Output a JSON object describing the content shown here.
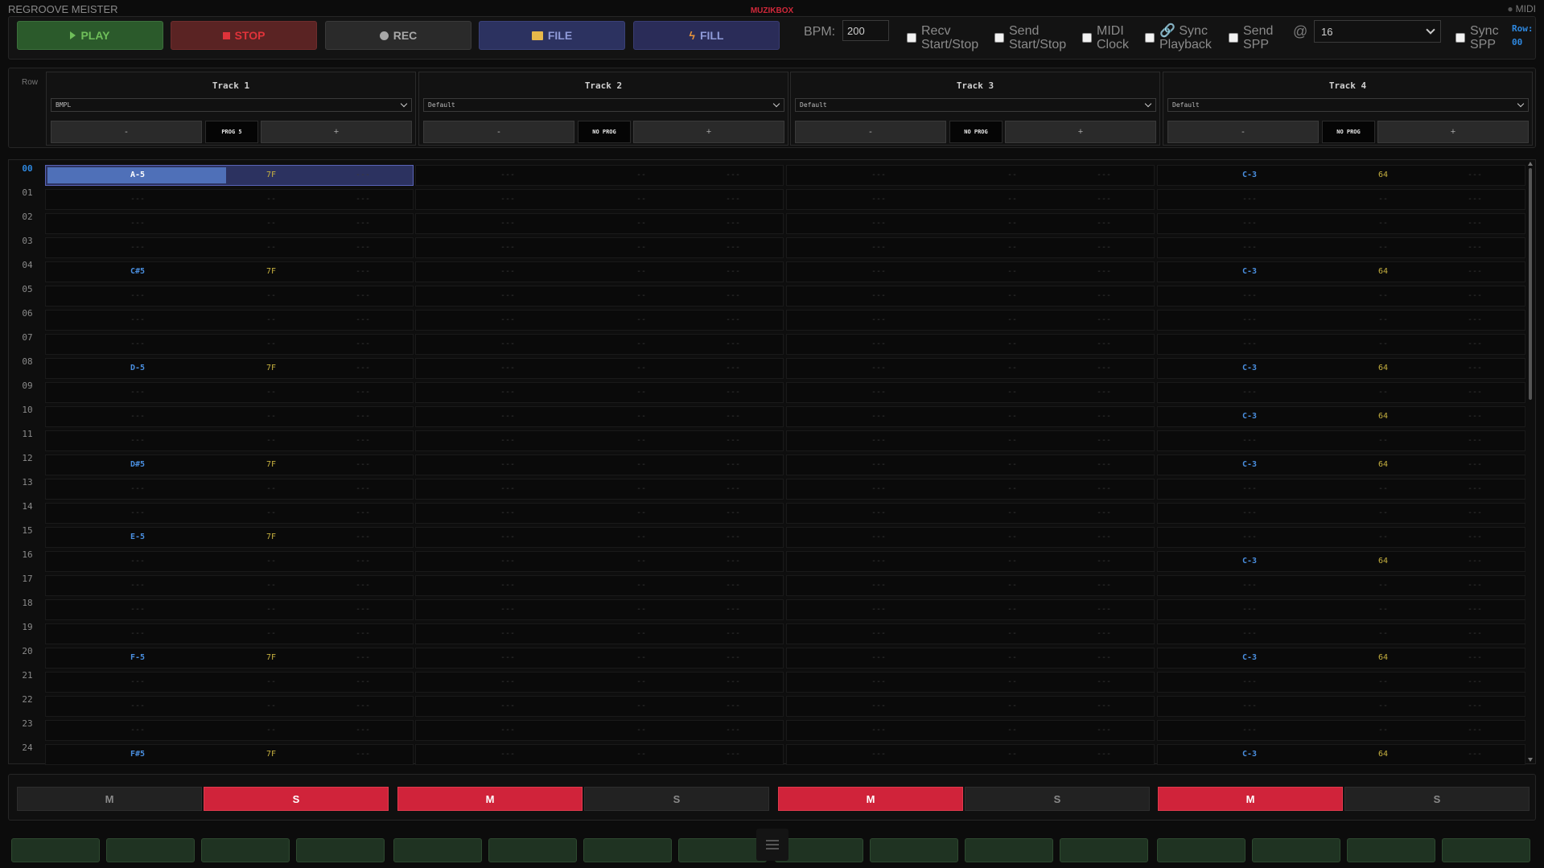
{
  "app": {
    "title": "REGROOVE MEISTER",
    "brand": "MUZIKBOX",
    "midi_status": "MIDI"
  },
  "toolbar": {
    "play": "PLAY",
    "stop": "STOP",
    "rec": "REC",
    "file": "FILE",
    "fill": "FILL",
    "bpm_label": "BPM:",
    "bpm_value": "200",
    "recv_start_stop": [
      "Recv",
      "Start/Stop"
    ],
    "send_start_stop": [
      "Send",
      "Start/Stop"
    ],
    "midi_clock": [
      "MIDI",
      "Clock"
    ],
    "sync_playback": [
      "Sync",
      "Playback"
    ],
    "send_spp": [
      "Send",
      "SPP"
    ],
    "at_symbol": "@",
    "spp_interval": "16",
    "sync_spp": [
      "Sync",
      "SPP"
    ],
    "row_label": "Row:",
    "row_value": "00"
  },
  "header": {
    "row_caption": "Row",
    "tracks": [
      {
        "name": "Track 1",
        "instrument": "BMPL",
        "minus": "-",
        "prog": "PROG 5",
        "plus": "+"
      },
      {
        "name": "Track 2",
        "instrument": "Default",
        "minus": "-",
        "prog": "NO PROG",
        "plus": "+"
      },
      {
        "name": "Track 3",
        "instrument": "Default",
        "minus": "-",
        "prog": "NO PROG",
        "plus": "+"
      },
      {
        "name": "Track 4",
        "instrument": "Default",
        "minus": "-",
        "prog": "NO PROG",
        "plus": "+"
      }
    ]
  },
  "pattern": {
    "current_row": 0,
    "empty_note": "---",
    "empty_vel": "--",
    "empty_fx": "---",
    "rows": [
      {
        "num": "00",
        "t1": [
          "A-5",
          "7F"
        ],
        "t4": [
          "C-3",
          "64"
        ]
      },
      {
        "num": "01"
      },
      {
        "num": "02"
      },
      {
        "num": "03"
      },
      {
        "num": "04",
        "t1": [
          "C#5",
          "7F"
        ],
        "t4": [
          "C-3",
          "64"
        ]
      },
      {
        "num": "05"
      },
      {
        "num": "06"
      },
      {
        "num": "07"
      },
      {
        "num": "08",
        "t1": [
          "D-5",
          "7F"
        ],
        "t4": [
          "C-3",
          "64"
        ]
      },
      {
        "num": "09"
      },
      {
        "num": "10",
        "t4": [
          "C-3",
          "64"
        ]
      },
      {
        "num": "11"
      },
      {
        "num": "12",
        "t1": [
          "D#5",
          "7F"
        ],
        "t4": [
          "C-3",
          "64"
        ]
      },
      {
        "num": "13"
      },
      {
        "num": "14"
      },
      {
        "num": "15",
        "t1": [
          "E-5",
          "7F"
        ]
      },
      {
        "num": "16",
        "t4": [
          "C-3",
          "64"
        ]
      },
      {
        "num": "17"
      },
      {
        "num": "18"
      },
      {
        "num": "19"
      },
      {
        "num": "20",
        "t1": [
          "F-5",
          "7F"
        ],
        "t4": [
          "C-3",
          "64"
        ]
      },
      {
        "num": "21"
      },
      {
        "num": "22"
      },
      {
        "num": "23"
      },
      {
        "num": "24",
        "t1": [
          "F#5",
          "7F"
        ],
        "t4": [
          "C-3",
          "64"
        ]
      }
    ]
  },
  "mute_solo": [
    {
      "label": "M",
      "active": false
    },
    {
      "label": "S",
      "active": true
    },
    {
      "label": "M",
      "active": true
    },
    {
      "label": "S",
      "active": false
    },
    {
      "label": "M",
      "active": true
    },
    {
      "label": "S",
      "active": false
    },
    {
      "label": "M",
      "active": true
    },
    {
      "label": "S",
      "active": false
    }
  ],
  "pads_count": 16,
  "colors": {
    "accent_blue": "#2e88e0",
    "active_red": "#d0233a",
    "note_blue": "#4a8fe0",
    "velocity_yellow": "#c8b240"
  }
}
